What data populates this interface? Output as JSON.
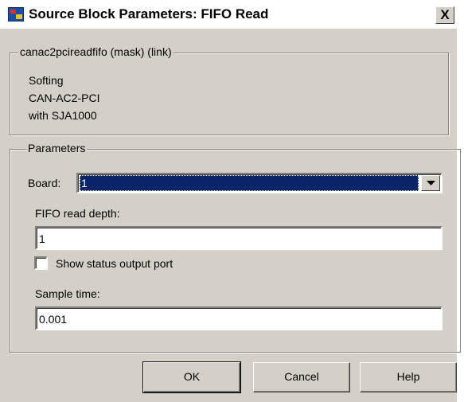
{
  "window": {
    "title": "Source Block Parameters: FIFO Read",
    "close_glyph": "X"
  },
  "mask": {
    "legend": "canac2pcireadfifo (mask) (link)",
    "description_lines": [
      "Softing",
      "CAN-AC2-PCI",
      "with SJA1000"
    ]
  },
  "parameters": {
    "legend": "Parameters",
    "board": {
      "label": "Board:",
      "value": "1"
    },
    "fifo_depth": {
      "label": "FIFO read depth:",
      "value": "1"
    },
    "show_status": {
      "label": "Show status output port",
      "checked": false
    },
    "sample_time": {
      "label": "Sample time:",
      "value": "0.001"
    }
  },
  "buttons": {
    "ok": "OK",
    "cancel": "Cancel",
    "help": "Help"
  }
}
